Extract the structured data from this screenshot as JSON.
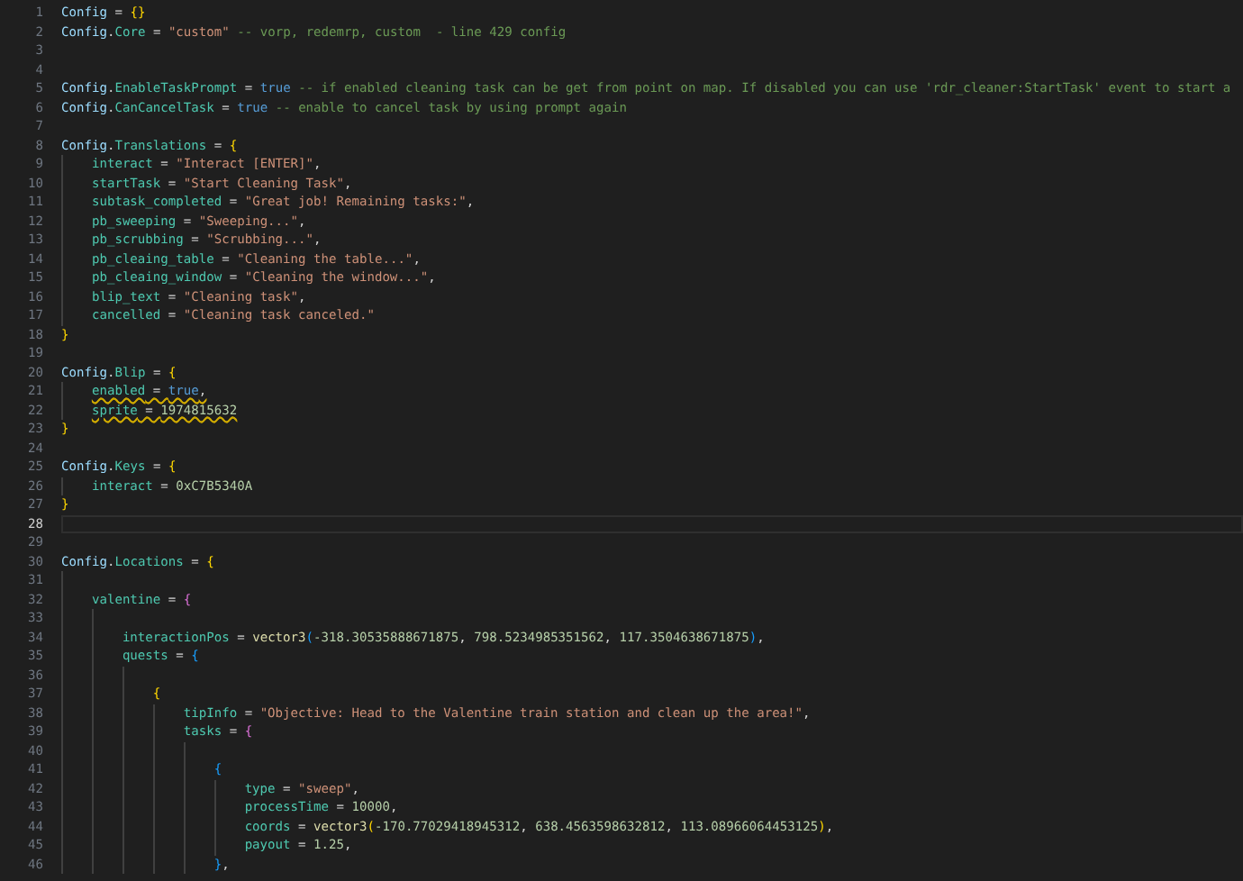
{
  "editor": {
    "lines": [
      {
        "number": "1",
        "current": false,
        "warning": false,
        "tokens": [
          {
            "kind": "var",
            "text": "Config"
          },
          {
            "kind": "op",
            "text": " = "
          },
          {
            "kind": "b1",
            "text": "{}"
          }
        ]
      },
      {
        "number": "2",
        "current": false,
        "warning": false,
        "tokens": [
          {
            "kind": "var",
            "text": "Config"
          },
          {
            "kind": "op",
            "text": "."
          },
          {
            "kind": "field",
            "text": "Core"
          },
          {
            "kind": "op",
            "text": " = "
          },
          {
            "kind": "str",
            "text": "\"custom\""
          },
          {
            "kind": "com",
            "text": " -- vorp, redemrp, custom  - line 429 config"
          }
        ]
      },
      {
        "number": "3",
        "current": false
      },
      {
        "number": "4",
        "current": false
      },
      {
        "number": "5",
        "current": false,
        "warning": false,
        "tokens": [
          {
            "kind": "var",
            "text": "Config"
          },
          {
            "kind": "op",
            "text": "."
          },
          {
            "kind": "field",
            "text": "EnableTaskPrompt"
          },
          {
            "kind": "op",
            "text": " = "
          },
          {
            "kind": "kw",
            "text": "true"
          },
          {
            "kind": "com",
            "text": " -- if enabled cleaning task can be get from point on map. If disabled you can use 'rdr_cleaner:StartTask' event to start a"
          }
        ]
      },
      {
        "number": "6",
        "current": false,
        "warning": false,
        "tokens": [
          {
            "kind": "var",
            "text": "Config"
          },
          {
            "kind": "op",
            "text": "."
          },
          {
            "kind": "field",
            "text": "CanCancelTask"
          },
          {
            "kind": "op",
            "text": " = "
          },
          {
            "kind": "kw",
            "text": "true"
          },
          {
            "kind": "com",
            "text": " -- enable to cancel task by using prompt again"
          }
        ]
      },
      {
        "number": "7",
        "current": false
      },
      {
        "number": "8",
        "current": false,
        "warning": false,
        "tokens": [
          {
            "kind": "var",
            "text": "Config"
          },
          {
            "kind": "op",
            "text": "."
          },
          {
            "kind": "field",
            "text": "Translations"
          },
          {
            "kind": "op",
            "text": " = "
          },
          {
            "kind": "b1",
            "text": "{"
          }
        ],
        "children": [
          {
            "number": "9",
            "current": false,
            "warning": false,
            "tokens": [
              {
                "kind": "field",
                "text": "interact"
              },
              {
                "kind": "op",
                "text": " = "
              },
              {
                "kind": "str",
                "text": "\"Interact [ENTER]\""
              },
              {
                "kind": "op",
                "text": ","
              }
            ]
          },
          {
            "number": "10",
            "current": false,
            "warning": false,
            "tokens": [
              {
                "kind": "field",
                "text": "startTask"
              },
              {
                "kind": "op",
                "text": " = "
              },
              {
                "kind": "str",
                "text": "\"Start Cleaning Task\""
              },
              {
                "kind": "op",
                "text": ","
              }
            ]
          },
          {
            "number": "11",
            "current": false,
            "warning": false,
            "tokens": [
              {
                "kind": "field",
                "text": "subtask_completed"
              },
              {
                "kind": "op",
                "text": " = "
              },
              {
                "kind": "str",
                "text": "\"Great job! Remaining tasks:\""
              },
              {
                "kind": "op",
                "text": ","
              }
            ]
          },
          {
            "number": "12",
            "current": false,
            "warning": false,
            "tokens": [
              {
                "kind": "field",
                "text": "pb_sweeping"
              },
              {
                "kind": "op",
                "text": " = "
              },
              {
                "kind": "str",
                "text": "\"Sweeping...\""
              },
              {
                "kind": "op",
                "text": ","
              }
            ]
          },
          {
            "number": "13",
            "current": false,
            "warning": false,
            "tokens": [
              {
                "kind": "field",
                "text": "pb_scrubbing"
              },
              {
                "kind": "op",
                "text": " = "
              },
              {
                "kind": "str",
                "text": "\"Scrubbing...\""
              },
              {
                "kind": "op",
                "text": ","
              }
            ]
          },
          {
            "number": "14",
            "current": false,
            "warning": false,
            "tokens": [
              {
                "kind": "field",
                "text": "pb_cleaing_table"
              },
              {
                "kind": "op",
                "text": " = "
              },
              {
                "kind": "str",
                "text": "\"Cleaning the table...\""
              },
              {
                "kind": "op",
                "text": ","
              }
            ]
          },
          {
            "number": "15",
            "current": false,
            "warning": false,
            "tokens": [
              {
                "kind": "field",
                "text": "pb_cleaing_window"
              },
              {
                "kind": "op",
                "text": " = "
              },
              {
                "kind": "str",
                "text": "\"Cleaning the window...\""
              },
              {
                "kind": "op",
                "text": ","
              }
            ]
          },
          {
            "number": "16",
            "current": false,
            "warning": false,
            "tokens": [
              {
                "kind": "field",
                "text": "blip_text"
              },
              {
                "kind": "op",
                "text": " = "
              },
              {
                "kind": "str",
                "text": "\"Cleaning task\""
              },
              {
                "kind": "op",
                "text": ","
              }
            ]
          },
          {
            "number": "17",
            "current": false,
            "warning": false,
            "tokens": [
              {
                "kind": "field",
                "text": "cancelled"
              },
              {
                "kind": "op",
                "text": " = "
              },
              {
                "kind": "str",
                "text": "\"Cleaning task canceled.\""
              }
            ]
          }
        ]
      },
      {
        "number": "18",
        "current": false,
        "warning": false,
        "tokens": [
          {
            "kind": "b1",
            "text": "}"
          }
        ]
      },
      {
        "number": "19",
        "current": false
      },
      {
        "number": "20",
        "current": false,
        "warning": false,
        "tokens": [
          {
            "kind": "var",
            "text": "Config"
          },
          {
            "kind": "op",
            "text": "."
          },
          {
            "kind": "field",
            "text": "Blip"
          },
          {
            "kind": "op",
            "text": " = "
          },
          {
            "kind": "b1",
            "text": "{"
          }
        ],
        "children": [
          {
            "number": "21",
            "current": false,
            "warning": true,
            "tokens": [
              {
                "kind": "field",
                "text": "enabled"
              },
              {
                "kind": "op",
                "text": " = "
              },
              {
                "kind": "kw",
                "text": "true"
              },
              {
                "kind": "op",
                "text": ","
              }
            ]
          },
          {
            "number": "22",
            "current": false,
            "warning": true,
            "tokens": [
              {
                "kind": "field",
                "text": "sprite"
              },
              {
                "kind": "op",
                "text": " = "
              },
              {
                "kind": "num",
                "text": "1974815632"
              }
            ]
          }
        ]
      },
      {
        "number": "23",
        "current": false,
        "warning": false,
        "tokens": [
          {
            "kind": "b1",
            "text": "}"
          }
        ]
      },
      {
        "number": "24",
        "current": false
      },
      {
        "number": "25",
        "current": false,
        "warning": false,
        "tokens": [
          {
            "kind": "var",
            "text": "Config"
          },
          {
            "kind": "op",
            "text": "."
          },
          {
            "kind": "field",
            "text": "Keys"
          },
          {
            "kind": "op",
            "text": " = "
          },
          {
            "kind": "b1",
            "text": "{"
          }
        ],
        "children": [
          {
            "number": "26",
            "current": false,
            "warning": false,
            "tokens": [
              {
                "kind": "field",
                "text": "interact"
              },
              {
                "kind": "op",
                "text": " = "
              },
              {
                "kind": "num",
                "text": "0xC7B5340A"
              }
            ]
          }
        ]
      },
      {
        "number": "27",
        "current": false,
        "warning": false,
        "tokens": [
          {
            "kind": "b1",
            "text": "}"
          }
        ]
      },
      {
        "number": "28",
        "current": true
      },
      {
        "number": "29",
        "current": false
      },
      {
        "number": "30",
        "current": false,
        "warning": false,
        "tokens": [
          {
            "kind": "var",
            "text": "Config"
          },
          {
            "kind": "op",
            "text": "."
          },
          {
            "kind": "field",
            "text": "Locations"
          },
          {
            "kind": "op",
            "text": " = "
          },
          {
            "kind": "b1",
            "text": "{"
          }
        ],
        "children": [
          {
            "number": "31",
            "current": false
          },
          {
            "number": "32",
            "current": false,
            "warning": false,
            "tokens": [
              {
                "kind": "field",
                "text": "valentine"
              },
              {
                "kind": "op",
                "text": " = "
              },
              {
                "kind": "b2",
                "text": "{"
              }
            ],
            "children": [
              {
                "number": "33",
                "current": false
              },
              {
                "number": "34",
                "current": false,
                "warning": false,
                "tokens": [
                  {
                    "kind": "field",
                    "text": "interactionPos"
                  },
                  {
                    "kind": "op",
                    "text": " = "
                  },
                  {
                    "kind": "fn",
                    "text": "vector3"
                  },
                  {
                    "kind": "b3",
                    "text": "("
                  },
                  {
                    "kind": "num",
                    "text": "-318.30535888671875"
                  },
                  {
                    "kind": "op",
                    "text": ", "
                  },
                  {
                    "kind": "num",
                    "text": "798.5234985351562"
                  },
                  {
                    "kind": "op",
                    "text": ", "
                  },
                  {
                    "kind": "num",
                    "text": "117.3504638671875"
                  },
                  {
                    "kind": "b3",
                    "text": ")"
                  },
                  {
                    "kind": "op",
                    "text": ","
                  }
                ]
              },
              {
                "number": "35",
                "current": false,
                "warning": false,
                "tokens": [
                  {
                    "kind": "field",
                    "text": "quests"
                  },
                  {
                    "kind": "op",
                    "text": " = "
                  },
                  {
                    "kind": "b3",
                    "text": "{"
                  }
                ],
                "children": [
                  {
                    "number": "36",
                    "current": false
                  },
                  {
                    "number": "37",
                    "current": false,
                    "warning": false,
                    "tokens": [
                      {
                        "kind": "b1",
                        "text": "{"
                      }
                    ],
                    "children": [
                      {
                        "number": "38",
                        "current": false,
                        "warning": false,
                        "tokens": [
                          {
                            "kind": "field",
                            "text": "tipInfo"
                          },
                          {
                            "kind": "op",
                            "text": " = "
                          },
                          {
                            "kind": "str",
                            "text": "\"Objective: Head to the Valentine train station and clean up the area!\""
                          },
                          {
                            "kind": "op",
                            "text": ","
                          }
                        ]
                      },
                      {
                        "number": "39",
                        "current": false,
                        "warning": false,
                        "tokens": [
                          {
                            "kind": "field",
                            "text": "tasks"
                          },
                          {
                            "kind": "op",
                            "text": " = "
                          },
                          {
                            "kind": "b2",
                            "text": "{"
                          }
                        ],
                        "children": [
                          {
                            "number": "40",
                            "current": false
                          },
                          {
                            "number": "41",
                            "current": false,
                            "warning": false,
                            "tokens": [
                              {
                                "kind": "b3",
                                "text": "{"
                              }
                            ],
                            "children": [
                              {
                                "number": "42",
                                "current": false,
                                "warning": false,
                                "tokens": [
                                  {
                                    "kind": "field",
                                    "text": "type"
                                  },
                                  {
                                    "kind": "op",
                                    "text": " = "
                                  },
                                  {
                                    "kind": "str",
                                    "text": "\"sweep\""
                                  },
                                  {
                                    "kind": "op",
                                    "text": ","
                                  }
                                ]
                              },
                              {
                                "number": "43",
                                "current": false,
                                "warning": false,
                                "tokens": [
                                  {
                                    "kind": "field",
                                    "text": "processTime"
                                  },
                                  {
                                    "kind": "op",
                                    "text": " = "
                                  },
                                  {
                                    "kind": "num",
                                    "text": "10000"
                                  },
                                  {
                                    "kind": "op",
                                    "text": ","
                                  }
                                ]
                              },
                              {
                                "number": "44",
                                "current": false,
                                "warning": false,
                                "tokens": [
                                  {
                                    "kind": "field",
                                    "text": "coords"
                                  },
                                  {
                                    "kind": "op",
                                    "text": " = "
                                  },
                                  {
                                    "kind": "fn",
                                    "text": "vector3"
                                  },
                                  {
                                    "kind": "b1",
                                    "text": "("
                                  },
                                  {
                                    "kind": "num",
                                    "text": "-170.77029418945312"
                                  },
                                  {
                                    "kind": "op",
                                    "text": ", "
                                  },
                                  {
                                    "kind": "num",
                                    "text": "638.4563598632812"
                                  },
                                  {
                                    "kind": "op",
                                    "text": ", "
                                  },
                                  {
                                    "kind": "num",
                                    "text": "113.08966064453125"
                                  },
                                  {
                                    "kind": "b1",
                                    "text": ")"
                                  },
                                  {
                                    "kind": "op",
                                    "text": ","
                                  }
                                ]
                              },
                              {
                                "number": "45",
                                "current": false,
                                "warning": false,
                                "tokens": [
                                  {
                                    "kind": "field",
                                    "text": "payout"
                                  },
                                  {
                                    "kind": "op",
                                    "text": " = "
                                  },
                                  {
                                    "kind": "num",
                                    "text": "1.25"
                                  },
                                  {
                                    "kind": "op",
                                    "text": ","
                                  }
                                ]
                              }
                            ]
                          },
                          {
                            "number": "46",
                            "current": false,
                            "warning": false,
                            "tokens": [
                              {
                                "kind": "b3",
                                "text": "}"
                              },
                              {
                                "kind": "op",
                                "text": ","
                              }
                            ]
                          }
                        ]
                      }
                    ]
                  }
                ]
              }
            ]
          }
        ]
      }
    ]
  }
}
